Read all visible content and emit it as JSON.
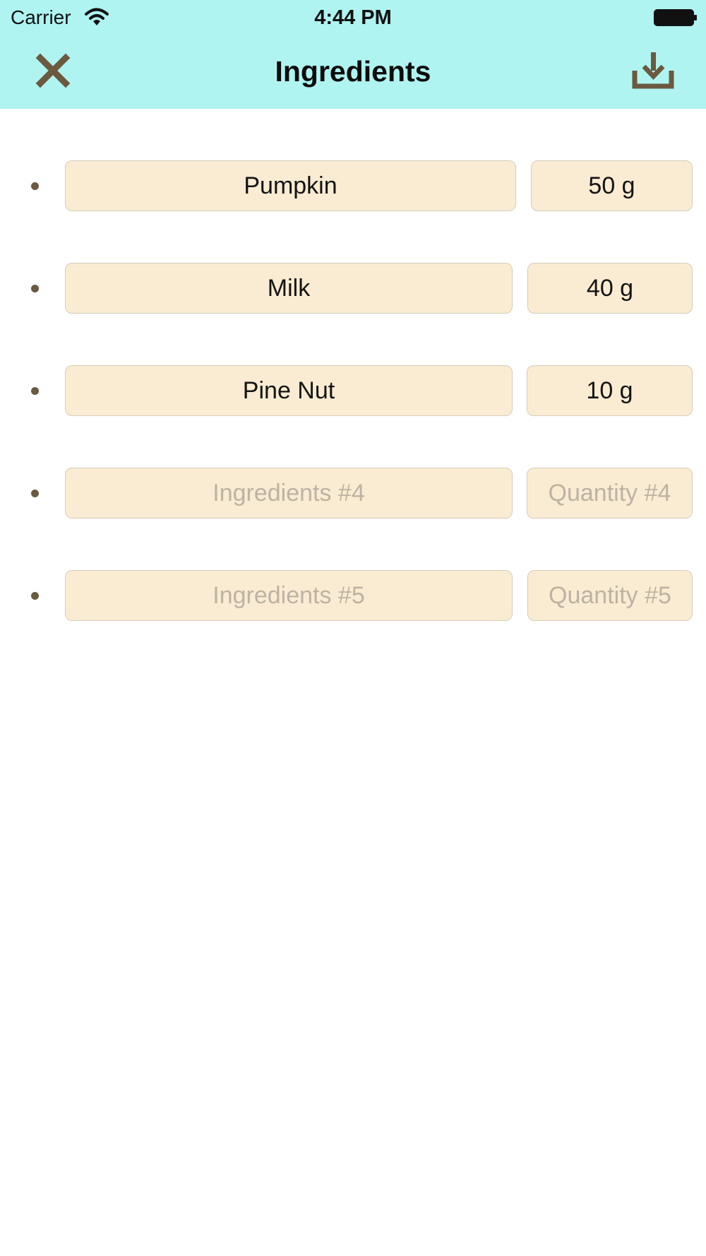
{
  "status_bar": {
    "carrier": "Carrier",
    "time": "4:44 PM",
    "icons": [
      "wifi-icon",
      "battery-icon"
    ]
  },
  "nav": {
    "title": "Ingredients",
    "left_icon": "close-icon",
    "right_icon": "download-icon"
  },
  "colors": {
    "header_bg": "#aff4f1",
    "field_bg": "#faecd2",
    "icon_brown": "#6b5940",
    "placeholder_text": "#bdb3a3"
  },
  "ingredients": [
    {
      "name": {
        "value": "Pumpkin",
        "placeholder": ""
      },
      "quantity": {
        "value": "50 g",
        "placeholder": ""
      }
    },
    {
      "name": {
        "value": "Milk",
        "placeholder": ""
      },
      "quantity": {
        "value": "40 g",
        "placeholder": ""
      }
    },
    {
      "name": {
        "value": "Pine Nut",
        "placeholder": ""
      },
      "quantity": {
        "value": "10 g",
        "placeholder": ""
      }
    },
    {
      "name": {
        "value": "",
        "placeholder": "Ingredients #4"
      },
      "quantity": {
        "value": "",
        "placeholder": "Quantity #4"
      }
    },
    {
      "name": {
        "value": "",
        "placeholder": "Ingredients #5"
      },
      "quantity": {
        "value": "",
        "placeholder": "Quantity #5"
      }
    }
  ]
}
